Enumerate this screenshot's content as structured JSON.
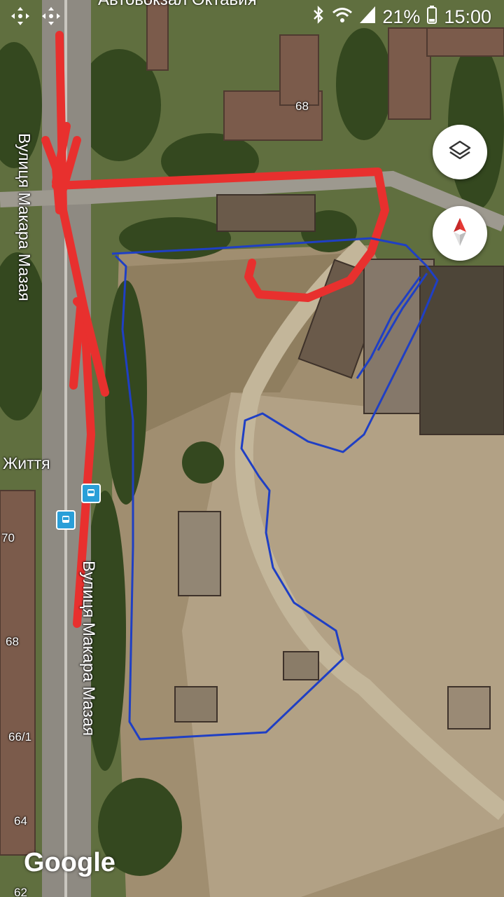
{
  "status_bar": {
    "battery_percent": "21%",
    "time": "15:00",
    "icons": [
      "move-icon",
      "move-icon",
      "bluetooth-icon",
      "wifi-icon",
      "signal-icon",
      "battery-icon"
    ]
  },
  "map": {
    "top_partial_label": "Автовокзал Октавия",
    "street_vertical_top": "Вулиця Макара Мазая",
    "street_vertical_bottom": "Вулиця Макара Мазая",
    "street_left": "Життя",
    "house_numbers": [
      "68",
      "70",
      "68",
      "66/1",
      "64",
      "62"
    ],
    "attribution": "Google",
    "colors": {
      "red_route": "#e8302e",
      "blue_route": "#1f3fc4"
    }
  },
  "controls": {
    "layers_button": "layers-icon",
    "compass_button": "compass-icon"
  }
}
